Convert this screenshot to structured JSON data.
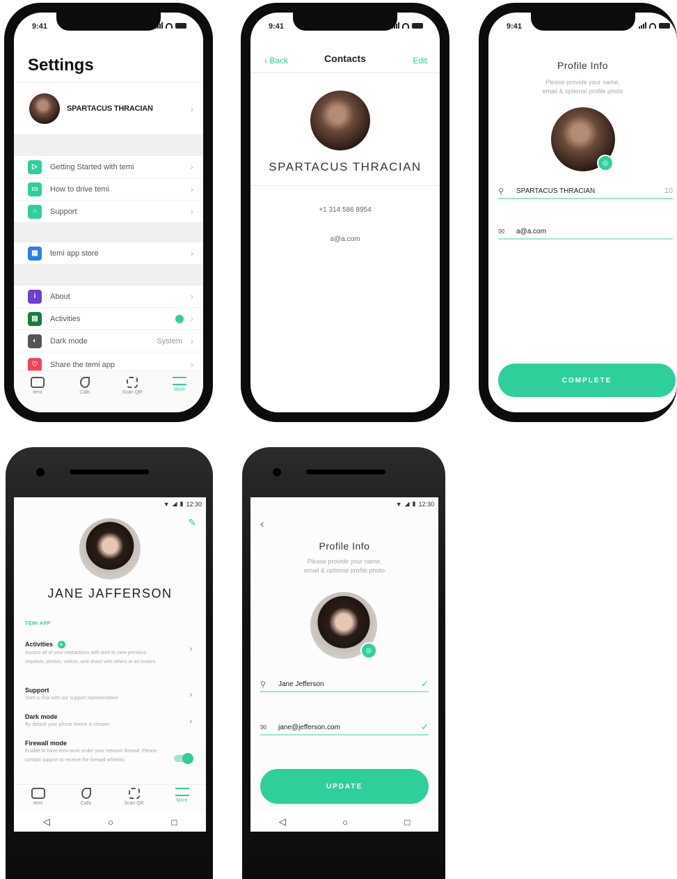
{
  "status": {
    "ios_time": "9:41",
    "android_time": "12:30"
  },
  "settings": {
    "title": "Settings",
    "profile_name": "SPARTACUS THRACIAN",
    "groups": [
      [
        {
          "icon": "play-icon",
          "label": "Getting Started with temi",
          "color": "#2fcf9b"
        },
        {
          "icon": "video-icon",
          "label": "How to drive temi",
          "color": "#2fcf9b"
        },
        {
          "icon": "headset-icon",
          "label": "Support",
          "color": "#2fcf9b"
        }
      ],
      [
        {
          "icon": "grid-icon",
          "label": "temi app store",
          "color": "#2a7df5"
        }
      ],
      [
        {
          "icon": "info-icon",
          "label": "About",
          "color": "#6c3fd6"
        },
        {
          "icon": "activities-icon",
          "label": "Activities",
          "color": "#1b7a3a"
        },
        {
          "icon": "moon-icon",
          "label": "Dark mode",
          "color": "#555555",
          "value": "System"
        },
        {
          "icon": "heart-icon",
          "label": "Share the temi app",
          "color": "#f2435b"
        }
      ]
    ],
    "tabs": [
      "temi",
      "Calls",
      "Scan QR",
      "More"
    ]
  },
  "contacts": {
    "back": "Back",
    "title": "Contacts",
    "edit": "Edit",
    "name": "SPARTACUS THRACIAN",
    "phone": "+1 314 586 8954",
    "email": "a@a.com"
  },
  "profile_ios": {
    "title": "Profile Info",
    "subtitle_1": "Please provide your name,",
    "subtitle_2": "email & optional profile photo",
    "name_value": "SPARTACUS THRACIAN",
    "name_count": "10",
    "email_value": "a@a.com",
    "button": "COMPLETE"
  },
  "android_settings": {
    "name": "JANE JAFFERSON",
    "section": "TEMI APP",
    "items": [
      {
        "title": "Activities",
        "desc": "Access all of your interactions with temi to view previous requests, photos, videos, and share with others at an instant."
      },
      {
        "title": "Support",
        "desc": "Start a chat with our support representative"
      },
      {
        "title": "Dark mode",
        "desc": "By default your phone theme is chosen"
      },
      {
        "title": "Firewall mode",
        "desc": "Enable to have temi work under your network firewall. Please contact support to receive the firewall whitelist."
      }
    ],
    "tabs": [
      "temi",
      "Calls",
      "Scan QR",
      "More"
    ],
    "firewall_on": true
  },
  "profile_android": {
    "title": "Profile Info",
    "subtitle_1": "Please provide your name,",
    "subtitle_2": "email & optional profile photo",
    "name_value": "Jane Jefferson",
    "email_value": "jane@jefferson.com",
    "button": "UPDATE"
  },
  "android_nav": {
    "back": "◁",
    "home": "○",
    "recents": "□"
  }
}
